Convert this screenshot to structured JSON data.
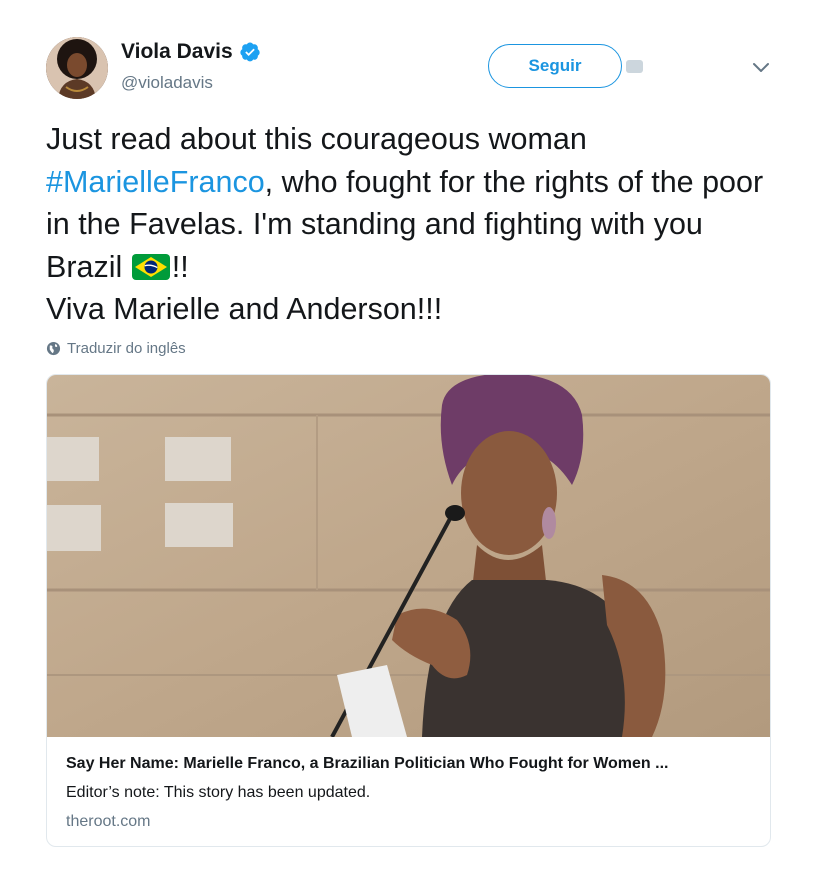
{
  "author": {
    "display_name": "Viola Davis",
    "handle": "@violadavis",
    "verified_icon": "verified-badge-icon",
    "avatar": "avatar"
  },
  "actions": {
    "follow_label": "Seguir",
    "menu_icon": "chevron-down-icon"
  },
  "tweet": {
    "text_part1": "Just read about this courageous woman ",
    "hashtag": "#MarielleFranco",
    "text_part2": ", who fought for the rights of the poor in the Favelas. I'm standing and fighting with you Brazil ",
    "emoji": "brazil-flag-emoji",
    "text_part3": "!!",
    "text_line2": "Viva Marielle and Anderson!!!",
    "translate_label": "Traduzir do inglês",
    "translate_icon": "globe-icon"
  },
  "card": {
    "image": "card-image",
    "title": "Say Her Name: Marielle Franco, a Brazilian Politician Who Fought for Women ...",
    "description": "Editor’s note: This story has been updated.",
    "domain": "theroot.com"
  },
  "colors": {
    "accent": "#1b95e0",
    "text": "#14171a",
    "secondary": "#657786",
    "border": "#e1e8ed"
  }
}
